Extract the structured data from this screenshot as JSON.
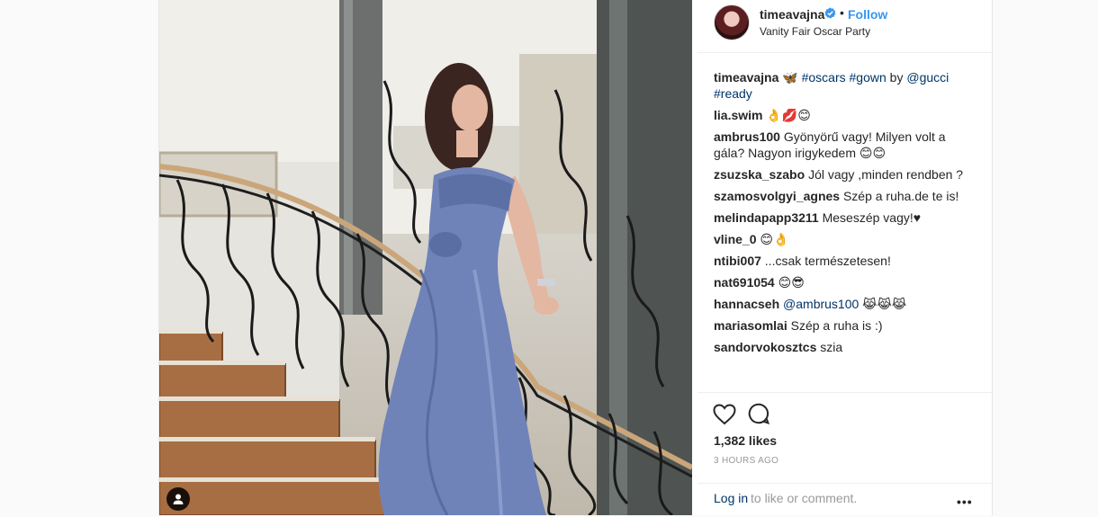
{
  "header": {
    "username": "timeavajna",
    "separator": "•",
    "follow_label": "Follow",
    "location": "Vanity Fair Oscar Party"
  },
  "comments": [
    {
      "user": "timeavajna",
      "parts": [
        {
          "text": "🦋 "
        },
        {
          "text": "#oscars",
          "tag": true
        },
        {
          "text": " "
        },
        {
          "text": "#gown",
          "tag": true
        },
        {
          "text": " by "
        },
        {
          "text": "@gucci",
          "tag": true
        },
        {
          "text": " "
        },
        {
          "text": "#ready",
          "tag": true
        }
      ]
    },
    {
      "user": "lia.swim",
      "parts": [
        {
          "text": "👌💋😊"
        }
      ]
    },
    {
      "user": "ambrus100",
      "parts": [
        {
          "text": "Gyönyörű vagy! Milyen volt a gála? Nagyon irigykedem 😊😊"
        }
      ]
    },
    {
      "user": "zsuzska_szabo",
      "parts": [
        {
          "text": "Jól vagy ,minden rendben ?"
        }
      ]
    },
    {
      "user": "szamosvolgyi_agnes",
      "parts": [
        {
          "text": "Szép a ruha.de te is!"
        }
      ]
    },
    {
      "user": "melindapapp3211",
      "parts": [
        {
          "text": "Meseszép vagy!♥"
        }
      ]
    },
    {
      "user": "vline_0",
      "parts": [
        {
          "text": "😊👌"
        }
      ]
    },
    {
      "user": "ntibi007",
      "parts": [
        {
          "text": "...csak természetesen!"
        }
      ]
    },
    {
      "user": "nat691054",
      "parts": [
        {
          "text": "😊😎"
        }
      ]
    },
    {
      "user": "hannacseh",
      "parts": [
        {
          "text": "@ambrus100",
          "tag": true
        },
        {
          "text": " 😹😹😹"
        }
      ]
    },
    {
      "user": "mariasomlai",
      "parts": [
        {
          "text": "Szép a ruha is :)"
        }
      ]
    },
    {
      "user": "sandorvokosztcs",
      "parts": [
        {
          "text": "szia"
        }
      ]
    }
  ],
  "actions": {
    "likes": "1,382 likes",
    "time": "3 HOURS AGO",
    "login_link": "Log in",
    "login_rest": " to like or comment.",
    "more": "•••"
  },
  "icons": {
    "like": "heart-icon",
    "comment": "comment-icon",
    "verified": "verified-badge-icon",
    "user_tag": "user-tag-icon",
    "more": "more-options-icon"
  },
  "colors": {
    "link": "#3897f0",
    "tag": "#003569",
    "muted": "#999999",
    "dress": "#6f83b8"
  }
}
